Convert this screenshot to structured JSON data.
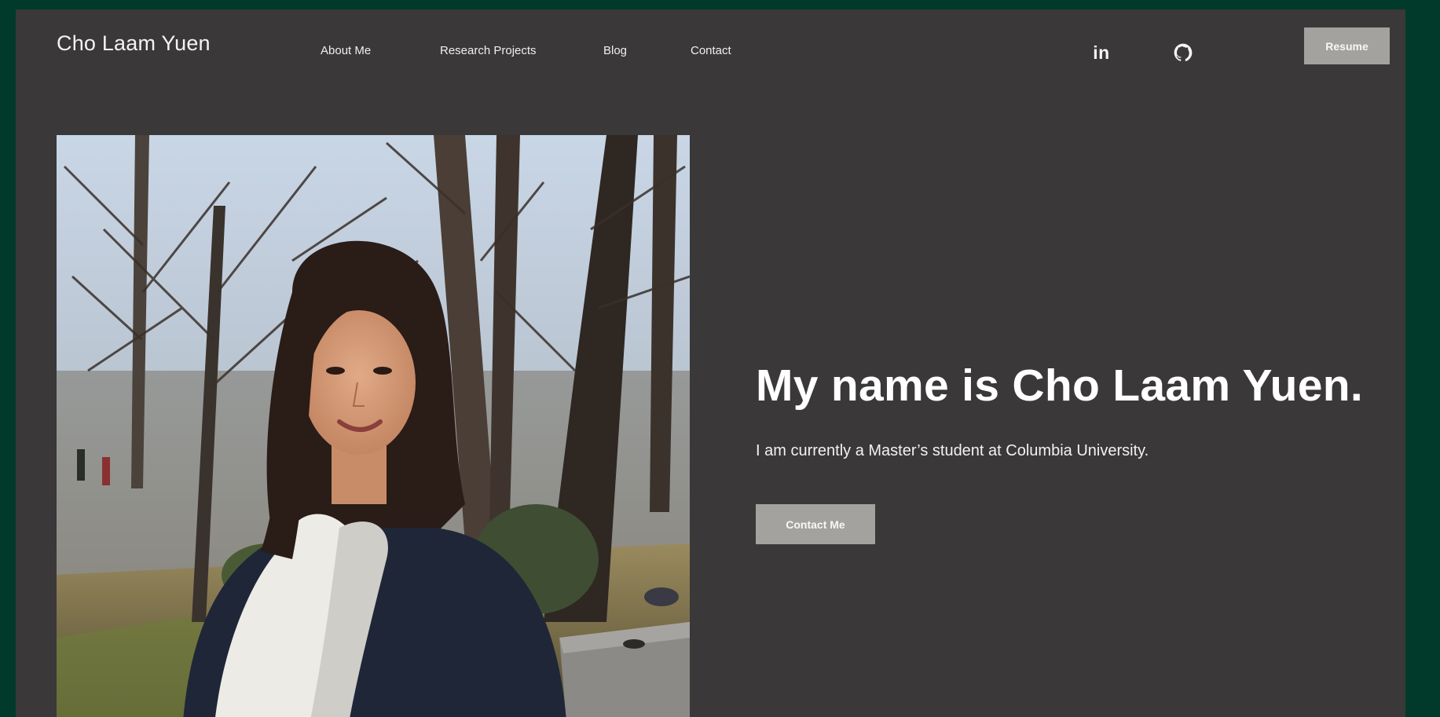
{
  "header": {
    "brand": "Cho Laam Yuen",
    "nav": [
      {
        "label": "About Me"
      },
      {
        "label": "Research Projects"
      },
      {
        "label": "Blog"
      },
      {
        "label": "Contact"
      }
    ],
    "social": {
      "linkedin": {
        "icon": "linkedin-icon",
        "glyph": "in"
      },
      "github": {
        "icon": "github-icon"
      }
    },
    "resume_label": "Resume"
  },
  "hero": {
    "title": "My name is Cho Laam Yuen.",
    "subtitle": "I am currently a Master’s student at Columbia University.",
    "cta_label": "Contact Me",
    "photo": {
      "icon": "profile-photo"
    }
  },
  "colors": {
    "outer_background": "#013a2b",
    "page_background": "#3a3839",
    "button_background": "#a4a29f",
    "text": "#ffffff"
  }
}
